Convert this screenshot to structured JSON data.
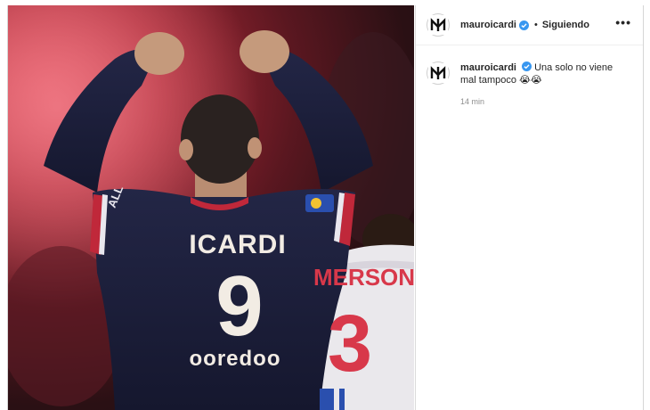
{
  "post": {
    "username": "mauroicardi",
    "verified": true,
    "separator": "•",
    "follow_status": "Siguiendo",
    "more_icon": "•••"
  },
  "caption": {
    "username": "mauroicardi",
    "text": "Una solo no viene mal tampoco",
    "emojis": "😭😭",
    "time": "14 min"
  },
  "photo": {
    "player_name": "ICARDI",
    "player_number": "9",
    "sponsor": "ooredoo",
    "sleeve_text": "ALL",
    "opponent_name": "MERSON",
    "opponent_number": "3"
  },
  "colors": {
    "verified_blue": "#3897f0",
    "jersey_navy": "#1e2140",
    "jersey_red": "#c0283a",
    "text_primary": "#262626",
    "text_secondary": "#8e8e8e"
  }
}
